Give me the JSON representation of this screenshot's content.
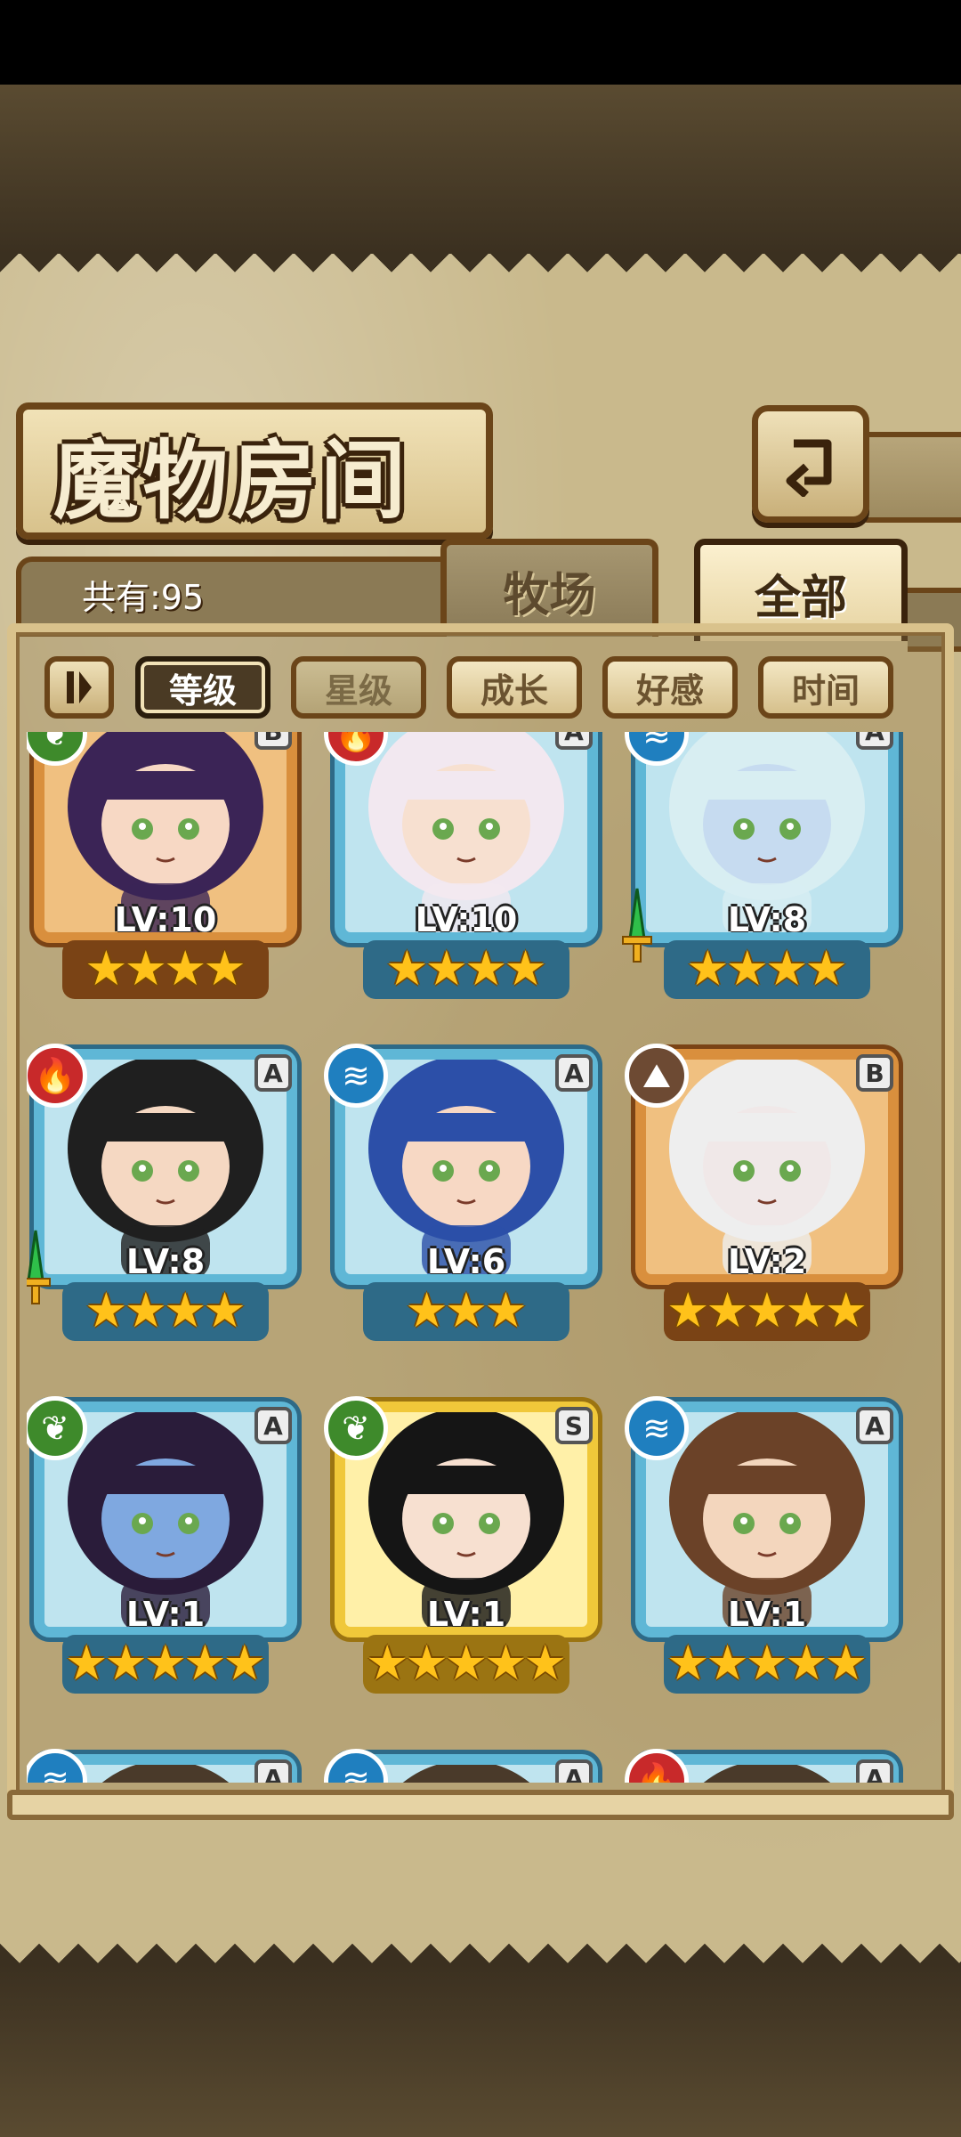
{
  "header": {
    "title": "魔物房间",
    "back_icon": "return-arrow-icon"
  },
  "inventory": {
    "count_label": "共有:95"
  },
  "tabs": [
    {
      "label": "牧场",
      "active": false
    },
    {
      "label": "全部",
      "active": true
    }
  ],
  "sort": {
    "toggle_icon": "sort-order-icon",
    "filters": [
      {
        "label": "等级",
        "active": true
      },
      {
        "label": "星级",
        "active": false
      },
      {
        "label": "成长",
        "active": false
      },
      {
        "label": "好感",
        "active": false
      },
      {
        "label": "时间",
        "active": false
      }
    ]
  },
  "monsters": [
    {
      "element": "leaf",
      "rank": "B",
      "level": "LV:10",
      "stars": 4,
      "weapon": false
    },
    {
      "element": "fire",
      "rank": "A",
      "level": "LV:10",
      "stars": 4,
      "weapon": false
    },
    {
      "element": "water",
      "rank": "A",
      "level": "LV:8",
      "stars": 4,
      "weapon": true
    },
    {
      "element": "fire",
      "rank": "A",
      "level": "LV:8",
      "stars": 4,
      "weapon": true
    },
    {
      "element": "water",
      "rank": "A",
      "level": "LV:6",
      "stars": 3,
      "weapon": false
    },
    {
      "element": "earth",
      "rank": "B",
      "level": "LV:2",
      "stars": 5,
      "weapon": false
    },
    {
      "element": "leaf",
      "rank": "A",
      "level": "LV:1",
      "stars": 5,
      "weapon": false
    },
    {
      "element": "leaf",
      "rank": "S",
      "level": "LV:1",
      "stars": 5,
      "weapon": false
    },
    {
      "element": "water",
      "rank": "A",
      "level": "LV:1",
      "stars": 5,
      "weapon": false
    },
    {
      "element": "water",
      "rank": "A",
      "level": "",
      "stars": 0,
      "weapon": false
    },
    {
      "element": "water",
      "rank": "A",
      "level": "",
      "stars": 0,
      "weapon": false
    },
    {
      "element": "fire",
      "rank": "A",
      "level": "",
      "stars": 0,
      "weapon": false
    }
  ]
}
